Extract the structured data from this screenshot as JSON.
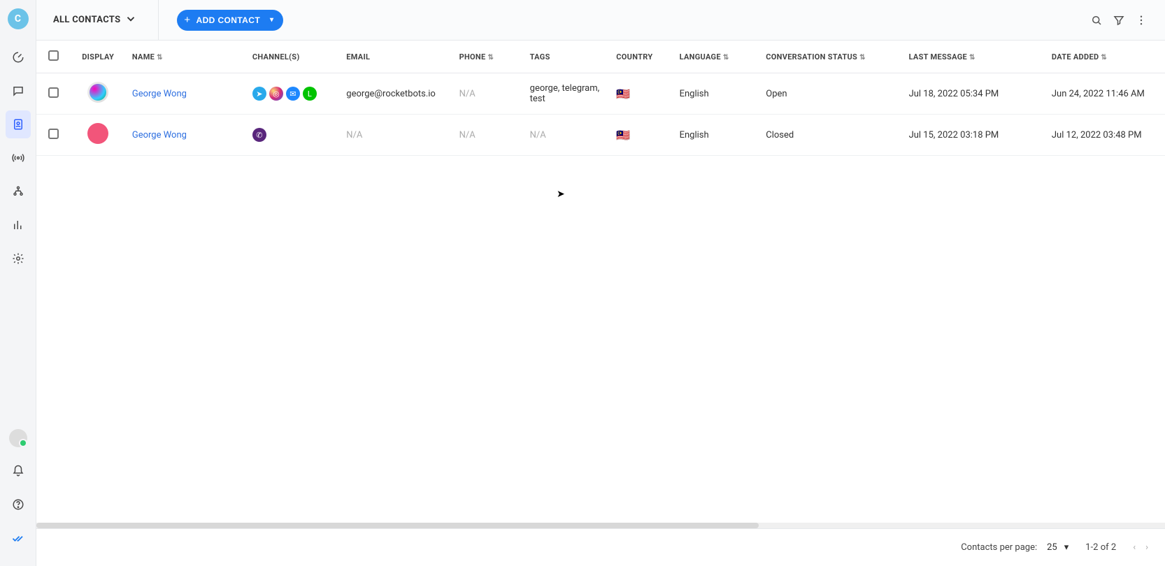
{
  "workspace": {
    "initial": "C"
  },
  "header": {
    "segment_label": "ALL CONTACTS",
    "add_contact_label": "ADD CONTACT"
  },
  "columns": {
    "display": "DISPLAY",
    "name": "NAME",
    "channels": "CHANNEL(S)",
    "email": "EMAIL",
    "phone": "PHONE",
    "tags": "TAGS",
    "country": "COUNTRY",
    "language": "LANGUAGE",
    "status": "CONVERSATION STATUS",
    "last_message": "LAST MESSAGE",
    "date_added": "DATE ADDED"
  },
  "rows": [
    {
      "avatar_class": "img1",
      "avatar_text": "",
      "name": "George Wong",
      "channels": [
        "telegram",
        "instagram",
        "messenger",
        "line"
      ],
      "email": "george@rocketbots.io",
      "phone": "N/A",
      "tags": "george, telegram, test",
      "country_flag": "🇲🇾",
      "language": "English",
      "status": "Open",
      "last_message": "Jul 18, 2022 05:34 PM",
      "date_added": "Jun 24, 2022 11:46 AM"
    },
    {
      "avatar_class": "pink",
      "avatar_text": "",
      "name": "George Wong",
      "channels": [
        "viber"
      ],
      "email": "N/A",
      "phone": "N/A",
      "tags": "N/A",
      "country_flag": "🇲🇾",
      "language": "English",
      "status": "Closed",
      "last_message": "Jul 15, 2022 03:18 PM",
      "date_added": "Jul 12, 2022 03:48 PM"
    }
  ],
  "pager": {
    "per_page_label": "Contacts per page:",
    "per_page_value": "25",
    "range": "1-2 of 2"
  },
  "channel_glyphs": {
    "telegram": "➤",
    "instagram": "◎",
    "messenger": "✉",
    "line": "L",
    "viber": "✆"
  }
}
